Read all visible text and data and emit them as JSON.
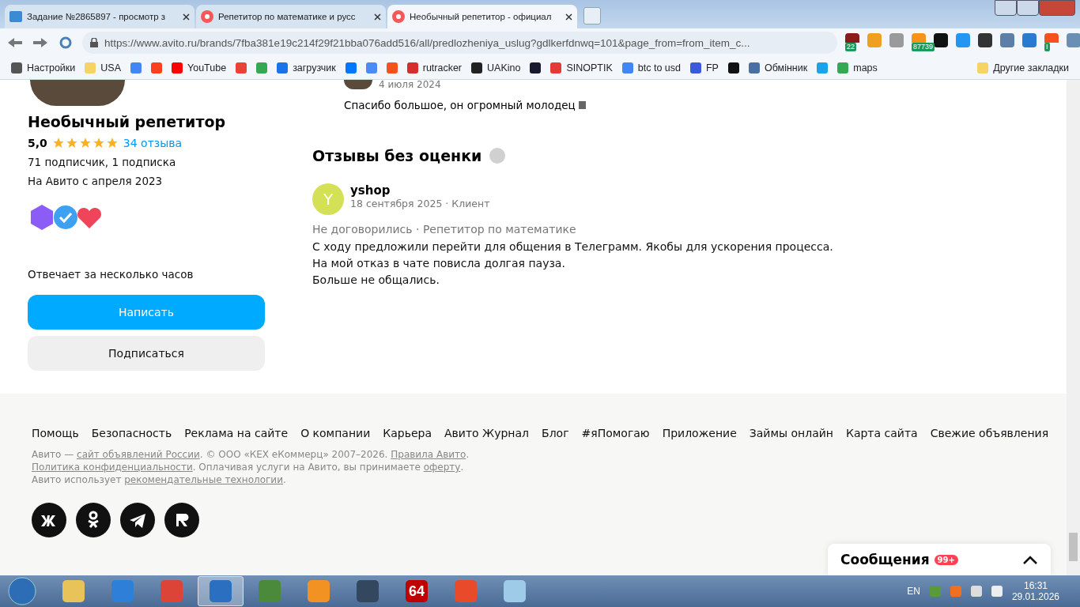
{
  "browser": {
    "tabs": [
      {
        "kind": "letters",
        "title": "Задание №2865897 - просмотр з",
        "selected": false
      },
      {
        "kind": "circle",
        "title": "Репетитор по математике и русс",
        "selected": false
      },
      {
        "kind": "circle",
        "title": "Необычный репетитор - официал",
        "selected": true
      }
    ],
    "url": "https://www.avito.ru/brands/7fba381e19c214f29f21bba076add516/all/predlozheniya_uslug?gdlkerfdnwq=101&page_from=from_item_c...",
    "extensions": [
      {
        "color": "#8b1a1a",
        "badge": "22"
      },
      {
        "color": "#f0a020"
      },
      {
        "color": "#9a9a9a"
      },
      {
        "color": "#f7931a",
        "badge": "87739"
      },
      {
        "color": "#111111"
      },
      {
        "color": "#2196f3"
      },
      {
        "color": "#333333"
      },
      {
        "color": "#5b7fa6"
      },
      {
        "color": "#2a7ad0"
      },
      {
        "color": "#f4511e",
        "badge": "I"
      },
      {
        "color": "#6a8fb5"
      }
    ],
    "bookmarks": [
      {
        "label": "Настройки",
        "color": "#555555"
      },
      {
        "label": "USA",
        "color": "#f6d365"
      },
      {
        "color": "#4285f4"
      },
      {
        "color": "#fc3f1d"
      },
      {
        "label": "YouTube",
        "color": "#ff0000"
      },
      {
        "color": "#ea4335"
      },
      {
        "color": "#34a853"
      },
      {
        "label": "загрузчик",
        "color": "#1a73e8"
      },
      {
        "color": "#0077ff"
      },
      {
        "color": "#4c8bf5"
      },
      {
        "color": "#f4511e"
      },
      {
        "label": "rutracker",
        "color": "#d62d2d"
      },
      {
        "label": "UAKino",
        "color": "#222222"
      },
      {
        "color": "#1a1a2e"
      },
      {
        "label": "SINOPTIK",
        "color": "#e53935"
      },
      {
        "label": "btc to usd",
        "color": "#4285f4"
      },
      {
        "label": "FP",
        "color": "#3b5bdb"
      },
      {
        "color": "#111111"
      },
      {
        "label": "Обмінник",
        "color": "#4a6fa5"
      },
      {
        "color": "#1aa3e8"
      },
      {
        "label": "maps",
        "color": "#34a853"
      }
    ],
    "other_bookmarks": "Другие закладки"
  },
  "previous_review": {
    "date": "4 июля 2024",
    "text": "Спасибо большое, он огромный молодец"
  },
  "profile": {
    "name": "Необычный репетитор",
    "rating": "5,0",
    "stars": 5,
    "reviews_link": "34 отзыва",
    "followers": "71 подписчик, 1 подписка",
    "since": "На Авито с апреля 2023",
    "response": "Отвечает за несколько часов",
    "write_button": "Написать",
    "subscribe_button": "Подписаться"
  },
  "unrated_reviews": {
    "title": "Отзывы без оценки",
    "items": [
      {
        "avatar_letter": "Y",
        "color": "#d4e157",
        "author": "yshop",
        "meta": "18 сентября 2025 · Клиент",
        "deal": "Не договорились · Репетитор по математике",
        "lines": [
          "С ходу предложили перейти для общения в Телеграмм. Якобы для ускорения процесса.",
          "На мой отказ в чате повисла долгая пауза.",
          "Больше не общались."
        ]
      }
    ]
  },
  "footer": {
    "links": [
      "Помощь",
      "Безопасность",
      "Реклама на сайте",
      "О компании",
      "Карьера",
      "Авито Журнал",
      "Блог",
      "#яПомогаю",
      "Приложение",
      "Займы онлайн",
      "Карта сайта",
      "Свежие объявления"
    ],
    "legal": [
      [
        {
          "text": "Авито — ",
          "link": false
        },
        {
          "text": "сайт объявлений России",
          "link": true
        },
        {
          "text": ". © ООО «КЕХ еКоммерц» 2007–2026. ",
          "link": false
        },
        {
          "text": "Правила Авито",
          "link": true
        },
        {
          "text": ".",
          "link": false
        }
      ],
      [
        {
          "text": "Политика конфиденциальности",
          "link": true
        },
        {
          "text": ". Оплачивая услуги на Авито, вы принимаете ",
          "link": false
        },
        {
          "text": "оферту",
          "link": true
        },
        {
          "text": ".",
          "link": false
        }
      ],
      [
        {
          "text": "Авито использует ",
          "link": false
        },
        {
          "text": "рекомендательные технологии",
          "link": true
        },
        {
          "text": ".",
          "link": false
        }
      ]
    ],
    "socials": [
      {
        "kind": "vk"
      },
      {
        "kind": "ok"
      },
      {
        "kind": "telegram"
      },
      {
        "kind": "rutube"
      }
    ]
  },
  "messages": {
    "title": "Сообщения",
    "badge": "99+"
  },
  "taskbar": {
    "apps": [
      {
        "kind": "folder",
        "selected": false
      },
      {
        "kind": "shield",
        "selected": false
      },
      {
        "kind": "chrome",
        "selected": false
      },
      {
        "kind": "globe",
        "selected": true
      },
      {
        "kind": "memory",
        "selected": false
      },
      {
        "kind": "player",
        "selected": false
      },
      {
        "kind": "clock",
        "selected": false
      },
      {
        "kind": "text",
        "label": "64",
        "selected": false
      },
      {
        "kind": "chart",
        "selected": false
      },
      {
        "kind": "notepad",
        "selected": false
      }
    ],
    "language": "EN",
    "time": "16:31",
    "date": "29.01.2026"
  }
}
